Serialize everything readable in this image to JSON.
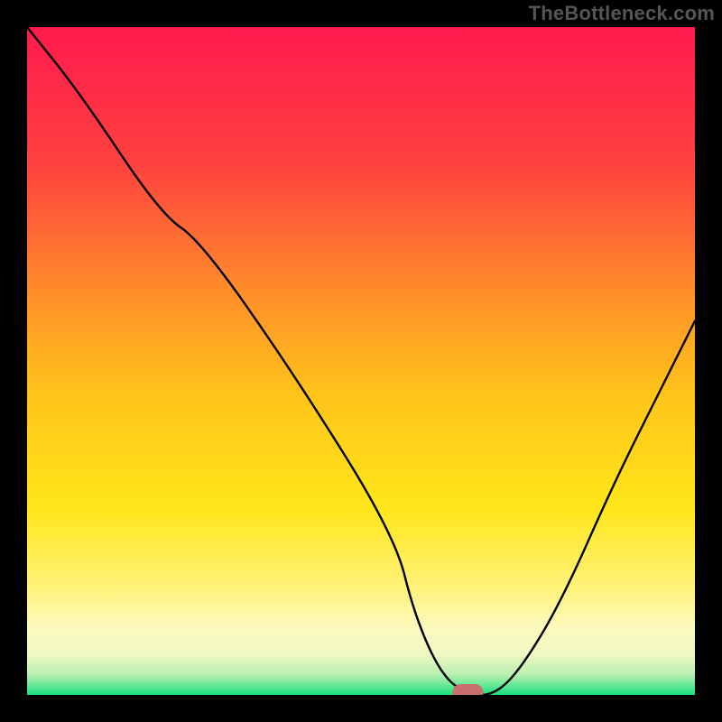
{
  "watermark": "TheBottleneck.com",
  "chart_data": {
    "type": "line",
    "title": "",
    "xlabel": "",
    "ylabel": "",
    "xlim": [
      0,
      100
    ],
    "ylim": [
      0,
      100
    ],
    "legend": false,
    "grid": false,
    "background_gradient": {
      "stops": [
        {
          "offset": 0.0,
          "color": "#ff1a4d"
        },
        {
          "offset": 0.2,
          "color": "#ff4040"
        },
        {
          "offset": 0.4,
          "color": "#ff8f2a"
        },
        {
          "offset": 0.55,
          "color": "#ffc41a"
        },
        {
          "offset": 0.72,
          "color": "#ffe61a"
        },
        {
          "offset": 0.84,
          "color": "#fff27a"
        },
        {
          "offset": 0.9,
          "color": "#fcfabf"
        },
        {
          "offset": 0.94,
          "color": "#f0f8c4"
        },
        {
          "offset": 0.97,
          "color": "#b6f0b0"
        },
        {
          "offset": 1.0,
          "color": "#18e07a"
        }
      ]
    },
    "series": [
      {
        "name": "bottleneck-curve",
        "color": "#000000",
        "x": [
          0,
          8,
          20,
          26,
          40,
          55,
          58,
          62,
          66,
          70,
          74,
          80,
          88,
          95,
          100
        ],
        "y": [
          100,
          90,
          72,
          68,
          48,
          24,
          12,
          3,
          0,
          0,
          4,
          14,
          32,
          46,
          56
        ]
      }
    ],
    "marker": {
      "name": "optimal-point",
      "x": 66,
      "y": 0,
      "color": "#c96f6f"
    }
  }
}
